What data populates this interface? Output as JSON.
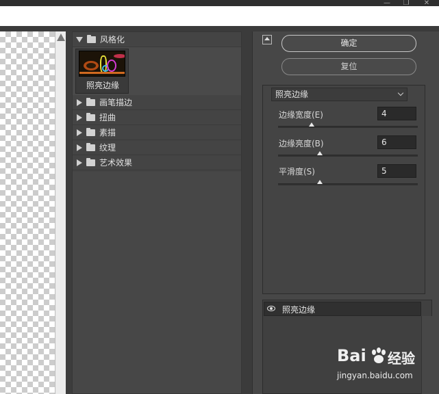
{
  "window": {
    "controls": [
      "—",
      "❐",
      "✕"
    ]
  },
  "filter_gallery": {
    "expanded_folder": {
      "label": "风格化"
    },
    "selected_filter": {
      "label": "照亮边缘"
    },
    "folders": [
      {
        "label": "画笔描边"
      },
      {
        "label": "扭曲"
      },
      {
        "label": "素描"
      },
      {
        "label": "纹理"
      },
      {
        "label": "艺术效果"
      }
    ]
  },
  "buttons": {
    "ok_label": "确定",
    "reset_label": "复位"
  },
  "settings": {
    "filter_select_value": "照亮边缘",
    "params": [
      {
        "label": "边缘宽度(E)",
        "value": "4",
        "slider_fraction": 0.24
      },
      {
        "label": "边缘亮度(B)",
        "value": "6",
        "slider_fraction": 0.3
      },
      {
        "label": "平滑度(S)",
        "value": "5",
        "slider_fraction": 0.3
      }
    ]
  },
  "effects_list": {
    "item_label": "照亮边缘"
  },
  "watermark": {
    "brand": "Bai",
    "brand_cn": "经验",
    "url": "jingyan.baidu.com"
  }
}
